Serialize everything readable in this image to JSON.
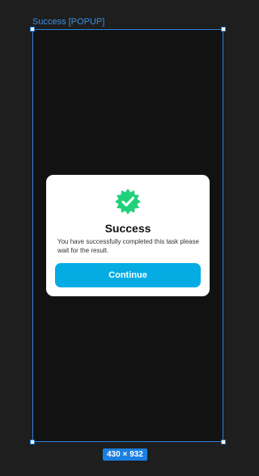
{
  "frame": {
    "label": "Success [POPUP]",
    "size_label": "430 × 932",
    "selection_color": "#2f7fdb"
  },
  "popup": {
    "icon": "verified-check-icon",
    "icon_color": "#1fd17a",
    "title": "Success",
    "message": "You have successfully completed this task please wait for the result.",
    "button_label": "Continue",
    "button_color": "#05ace3"
  }
}
